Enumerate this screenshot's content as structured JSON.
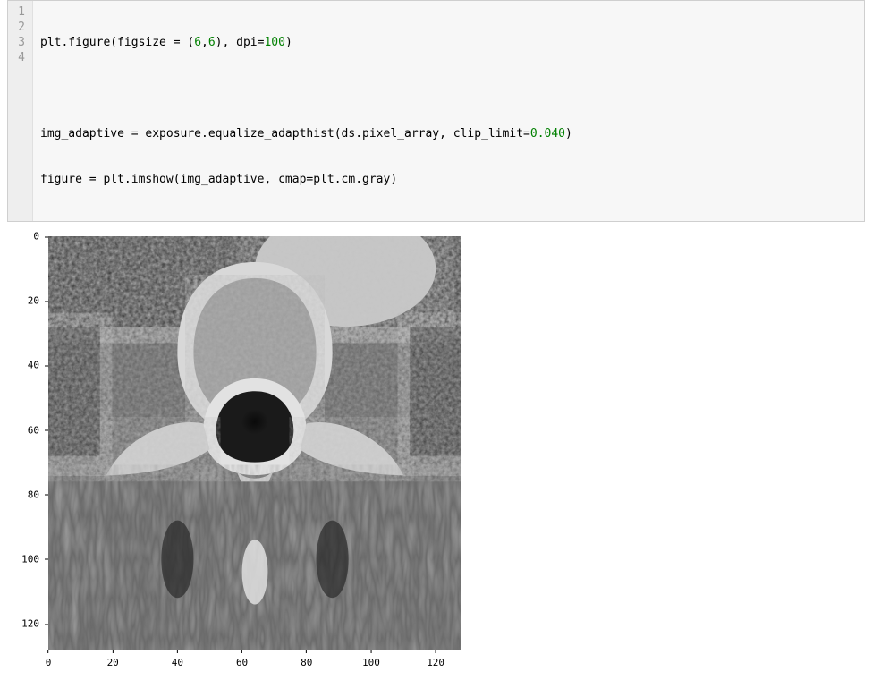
{
  "code": {
    "lines": [
      "plt.figure(figsize = (6,6), dpi=100)",
      "",
      "img_adaptive = exposure.equalize_adapthist(ds.pixel_array, clip_limit=0.040)",
      "figure = plt.imshow(img_adaptive, cmap=plt.cm.gray)"
    ],
    "line_numbers": [
      "1",
      "2",
      "3",
      "4"
    ]
  },
  "chart_data": {
    "type": "image",
    "description": "Grayscale CT scan axial slice (vertebra cross-section) after adaptive histogram equalization (CLAHE), clip_limit=0.040, cmap=gray",
    "xlim": [
      -0.5,
      127.5
    ],
    "ylim": [
      127.5,
      -0.5
    ],
    "x_ticks": [
      0,
      20,
      40,
      60,
      80,
      100,
      120
    ],
    "y_ticks": [
      0,
      20,
      40,
      60,
      80,
      100,
      120
    ],
    "image_dims": [
      128,
      128
    ]
  }
}
